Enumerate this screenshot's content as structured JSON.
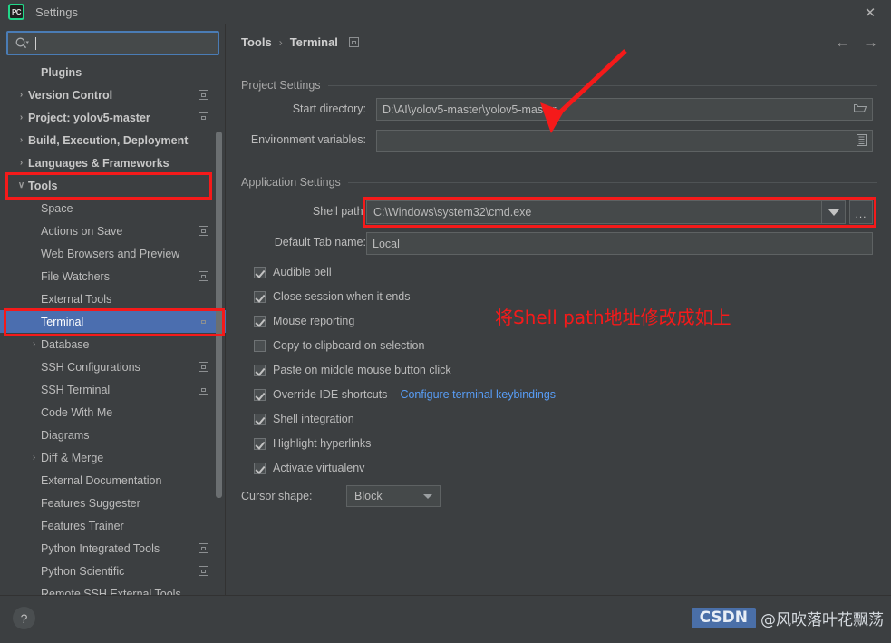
{
  "window": {
    "app_icon": "pycharm-icon",
    "app_icon_text": "PC",
    "title": "Settings",
    "close_label": "✕"
  },
  "sidebar": {
    "search": {
      "value": "",
      "placeholder": "",
      "icon": "search-icon"
    },
    "items": [
      {
        "label": "Plugins",
        "indent": 45,
        "bold": true,
        "arrow": "",
        "module": false,
        "selected": false
      },
      {
        "label": "Version Control",
        "indent": 31,
        "bold": true,
        "arrow": "›",
        "module": true,
        "selected": false
      },
      {
        "label": "Project: yolov5-master",
        "indent": 31,
        "bold": true,
        "arrow": "›",
        "module": true,
        "selected": false
      },
      {
        "label": "Build, Execution, Deployment",
        "indent": 31,
        "bold": true,
        "arrow": "›",
        "module": false,
        "selected": false
      },
      {
        "label": "Languages & Frameworks",
        "indent": 31,
        "bold": true,
        "arrow": "›",
        "module": false,
        "selected": false
      },
      {
        "label": "Tools",
        "indent": 31,
        "bold": true,
        "arrow": "∨",
        "module": false,
        "selected": false
      },
      {
        "label": "Space",
        "indent": 45,
        "bold": false,
        "arrow": "",
        "module": false,
        "selected": false
      },
      {
        "label": "Actions on Save",
        "indent": 45,
        "bold": false,
        "arrow": "",
        "module": true,
        "selected": false
      },
      {
        "label": "Web Browsers and Preview",
        "indent": 45,
        "bold": false,
        "arrow": "",
        "module": false,
        "selected": false
      },
      {
        "label": "File Watchers",
        "indent": 45,
        "bold": false,
        "arrow": "",
        "module": true,
        "selected": false
      },
      {
        "label": "External Tools",
        "indent": 45,
        "bold": false,
        "arrow": "",
        "module": false,
        "selected": false
      },
      {
        "label": "Terminal",
        "indent": 45,
        "bold": false,
        "arrow": "",
        "module": true,
        "selected": true
      },
      {
        "label": "Database",
        "indent": 45,
        "bold": false,
        "arrow": "›",
        "module": false,
        "selected": false
      },
      {
        "label": "SSH Configurations",
        "indent": 45,
        "bold": false,
        "arrow": "",
        "module": true,
        "selected": false
      },
      {
        "label": "SSH Terminal",
        "indent": 45,
        "bold": false,
        "arrow": "",
        "module": true,
        "selected": false
      },
      {
        "label": "Code With Me",
        "indent": 45,
        "bold": false,
        "arrow": "",
        "module": false,
        "selected": false
      },
      {
        "label": "Diagrams",
        "indent": 45,
        "bold": false,
        "arrow": "",
        "module": false,
        "selected": false
      },
      {
        "label": "Diff & Merge",
        "indent": 45,
        "bold": false,
        "arrow": "›",
        "module": false,
        "selected": false
      },
      {
        "label": "External Documentation",
        "indent": 45,
        "bold": false,
        "arrow": "",
        "module": false,
        "selected": false
      },
      {
        "label": "Features Suggester",
        "indent": 45,
        "bold": false,
        "arrow": "",
        "module": false,
        "selected": false
      },
      {
        "label": "Features Trainer",
        "indent": 45,
        "bold": false,
        "arrow": "",
        "module": false,
        "selected": false
      },
      {
        "label": "Python Integrated Tools",
        "indent": 45,
        "bold": false,
        "arrow": "",
        "module": true,
        "selected": false
      },
      {
        "label": "Python Scientific",
        "indent": 45,
        "bold": false,
        "arrow": "",
        "module": true,
        "selected": false
      },
      {
        "label": "Remote SSH External Tools",
        "indent": 45,
        "bold": false,
        "arrow": "",
        "module": false,
        "selected": false
      }
    ]
  },
  "main": {
    "breadcrumb": {
      "root": "Tools",
      "separator": "›",
      "leaf": "Terminal"
    },
    "nav": {
      "back": "←",
      "forward": "→"
    },
    "sections": {
      "project_settings": "Project Settings",
      "application_settings": "Application Settings"
    },
    "fields": {
      "start_directory": {
        "label": "Start directory:",
        "value": "D:\\AI\\yolov5-master\\yolov5-master",
        "trailing_icon": "folder-icon"
      },
      "environment_variables": {
        "label": "Environment variables:",
        "value": "",
        "trailing_icon": "list-icon"
      },
      "shell_path": {
        "label": "Shell path:",
        "value": "C:\\Windows\\system32\\cmd.exe",
        "dropdown_icon": "chevron-down-icon",
        "browse_label": "..."
      },
      "default_tab_name": {
        "label": "Default Tab name:",
        "value": "Local"
      },
      "cursor_shape": {
        "label": "Cursor shape:",
        "value": "Block"
      }
    },
    "checkboxes": [
      {
        "label": "Audible bell",
        "checked": true
      },
      {
        "label": "Close session when it ends",
        "checked": true
      },
      {
        "label": "Mouse reporting",
        "checked": true
      },
      {
        "label": "Copy to clipboard on selection",
        "checked": false
      },
      {
        "label": "Paste on middle mouse button click",
        "checked": true
      },
      {
        "label": "Override IDE shortcuts",
        "checked": true,
        "link": "Configure terminal keybindings"
      },
      {
        "label": "Shell integration",
        "checked": true
      },
      {
        "label": "Highlight hyperlinks",
        "checked": true
      },
      {
        "label": "Activate virtualenv",
        "checked": true
      }
    ]
  },
  "annotations": {
    "callout_text": "将Shell path地址修改成如上",
    "color": "#f51a1a",
    "boxes": [
      "tools-tree-item",
      "terminal-tree-item",
      "shell-path-field"
    ]
  },
  "footer": {
    "help": "?",
    "watermark_brand": "CSDN",
    "watermark_user": "@风吹落叶花飘荡"
  },
  "colors": {
    "background": "#3c3f41",
    "selection": "#4b6eaf",
    "accent_link": "#589df6",
    "annotation_red": "#f51a1a",
    "focus_border": "#4a7cb5"
  }
}
